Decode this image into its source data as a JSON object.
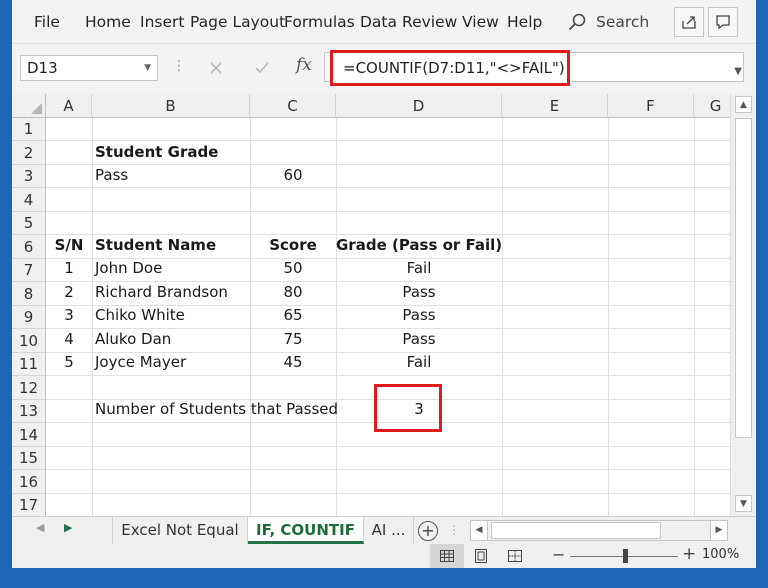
{
  "ribbon": {
    "tabs": [
      "File",
      "Home",
      "Insert",
      "Page Layout",
      "Formulas",
      "Data",
      "Review",
      "View",
      "Help"
    ],
    "search_label": "Search"
  },
  "formula_bar": {
    "name_box": "D13",
    "formula": "=COUNTIF(D7:D11,\"<>FAIL\")",
    "fx_label": "fx"
  },
  "columns": [
    "A",
    "B",
    "C",
    "D",
    "E",
    "F",
    "G"
  ],
  "rows": [
    "1",
    "2",
    "3",
    "4",
    "5",
    "6",
    "7",
    "8",
    "9",
    "10",
    "11",
    "12",
    "13",
    "14",
    "15",
    "16",
    "17"
  ],
  "cells": {
    "B2": "Student Grade",
    "B3": "Pass",
    "C3": "60",
    "A6": "S/N",
    "B6": "Student Name",
    "C6": "Score",
    "D6": "Grade (Pass or Fail)",
    "table": [
      {
        "sn": "1",
        "name": "John Doe",
        "score": "50",
        "grade": "Fail"
      },
      {
        "sn": "2",
        "name": "Richard Brandson",
        "score": "80",
        "grade": "Pass"
      },
      {
        "sn": "3",
        "name": "Chiko White",
        "score": "65",
        "grade": "Pass"
      },
      {
        "sn": "4",
        "name": "Aluko Dan",
        "score": "75",
        "grade": "Pass"
      },
      {
        "sn": "5",
        "name": "Joyce Mayer",
        "score": "45",
        "grade": "Fail"
      }
    ],
    "B13": "Number of Students that Passed",
    "D13": "3"
  },
  "sheet_tabs": [
    "Excel Not Equal",
    "IF, COUNTIF",
    "AI ..."
  ],
  "active_sheet": "IF, COUNTIF",
  "status": {
    "zoom": "100%"
  },
  "colors": {
    "highlight": "#e01b1b",
    "excel_green": "#217346",
    "frame": "#1e66b7"
  }
}
